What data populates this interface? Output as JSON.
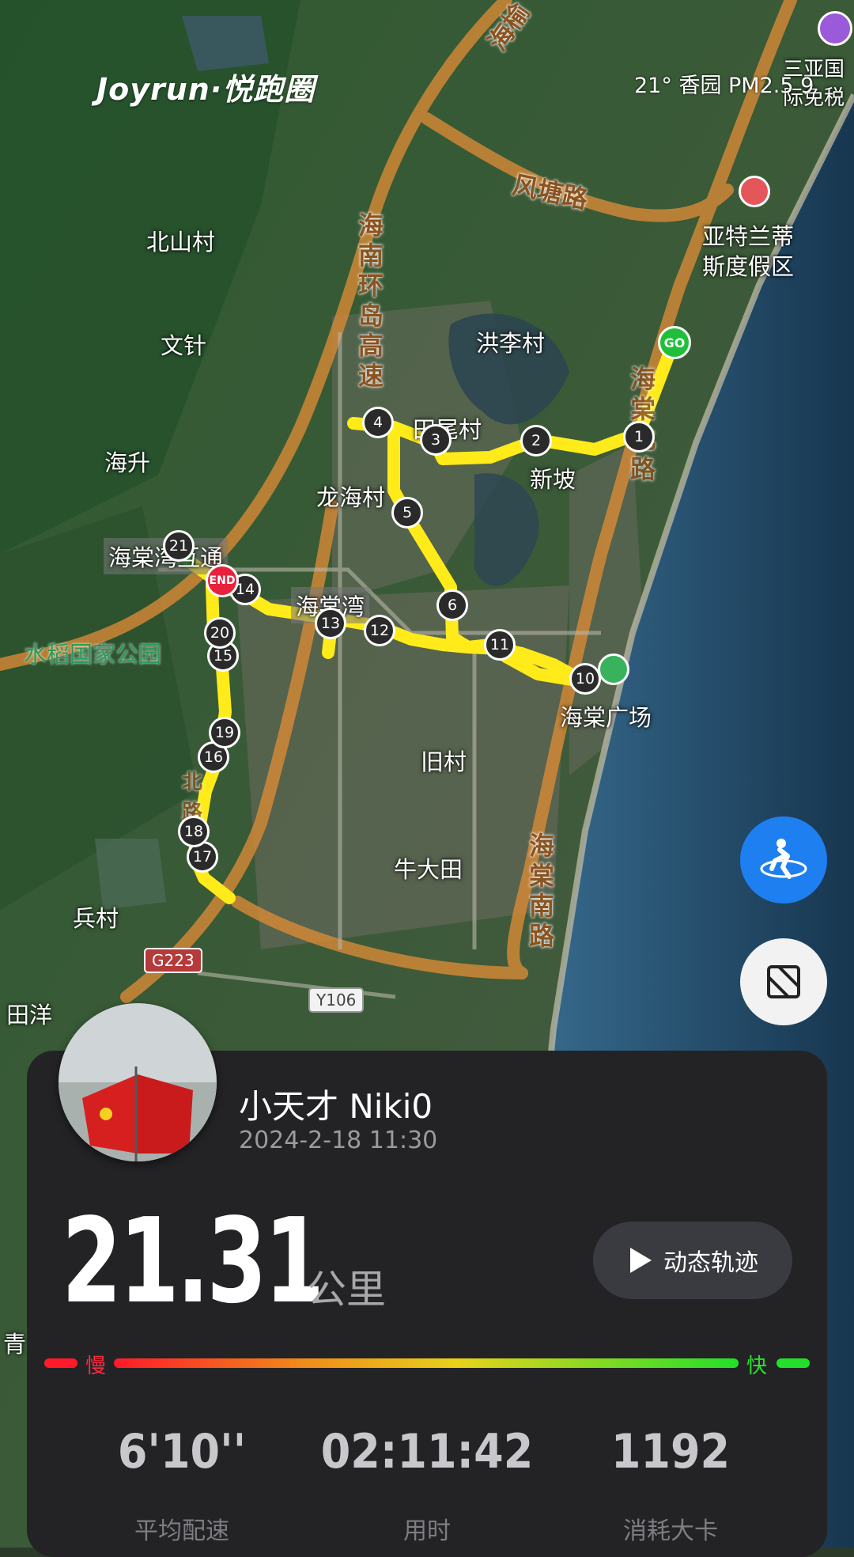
{
  "app": {
    "logo": "Joyrun·悦跑圈"
  },
  "weather": {
    "text": "21° 香园 PM2.5 9"
  },
  "map": {
    "places": [
      {
        "id": "beishancun",
        "label": "北山村"
      },
      {
        "id": "wenzhen",
        "label": "文针"
      },
      {
        "id": "haisheng",
        "label": "海升"
      },
      {
        "id": "hongli",
        "label": "洪李村"
      },
      {
        "id": "tianwei",
        "label": "田尾村"
      },
      {
        "id": "xinpo",
        "label": "新坡"
      },
      {
        "id": "longhai",
        "label": "龙海村"
      },
      {
        "id": "haitang_hutong",
        "label": "海棠湾互通"
      },
      {
        "id": "haitangwan",
        "label": "海棠湾"
      },
      {
        "id": "shuidao",
        "label": "水稻国家公园"
      },
      {
        "id": "jiucun",
        "label": "旧村"
      },
      {
        "id": "niudatian",
        "label": "牛大田"
      },
      {
        "id": "bingcun",
        "label": "兵村"
      },
      {
        "id": "tianyang",
        "label": "田洋"
      },
      {
        "id": "haitang_plaza",
        "label": "海棠广场"
      },
      {
        "id": "atlantis",
        "label": "亚特兰蒂斯度假区"
      },
      {
        "id": "duty_free",
        "label": "三亚国际免税"
      },
      {
        "id": "qing",
        "label": "青"
      }
    ],
    "roads": [
      {
        "id": "fengtang",
        "label": "风塘路"
      },
      {
        "id": "ring_express",
        "label": "海南环岛高速"
      },
      {
        "id": "haitang_south",
        "label": "海棠南路"
      },
      {
        "id": "haiyu",
        "label": "海榆"
      },
      {
        "id": "haitang_bei",
        "label": "海棠北路"
      },
      {
        "id": "zhenghe",
        "label": "北路"
      },
      {
        "id": "g223",
        "label": "G223"
      },
      {
        "id": "y106",
        "label": "Y106"
      }
    ],
    "markers": [
      "1",
      "2",
      "3",
      "4",
      "5",
      "6",
      "10",
      "11",
      "12",
      "13",
      "14",
      "15",
      "16",
      "17",
      "18",
      "19",
      "20",
      "21"
    ],
    "start_label": "GO",
    "end_label": "END"
  },
  "controls": {
    "runner_icon": "runner-icon",
    "screenshot_icon": "crop-frame-icon"
  },
  "card": {
    "user_name": "小天才 Niki0",
    "date": "2024-2-18 11:30",
    "distance": "21.31",
    "distance_unit": "公里",
    "replay_label": "动态轨迹",
    "slow_label": "慢",
    "fast_label": "快",
    "stats": [
      {
        "id": "pace",
        "value": "6'10''",
        "label": "平均配速"
      },
      {
        "id": "time",
        "value": "02:11:42",
        "label": "用时"
      },
      {
        "id": "calories",
        "value": "1192",
        "label": "消耗大卡"
      }
    ]
  },
  "colors": {
    "route": "#ffeb1a",
    "card_bg": "#232326",
    "go": "#1fbf3a",
    "end": "#e8213d",
    "fab_blue": "#1e7ff0",
    "slow": "#ff2a3c",
    "fast": "#27e22a"
  }
}
